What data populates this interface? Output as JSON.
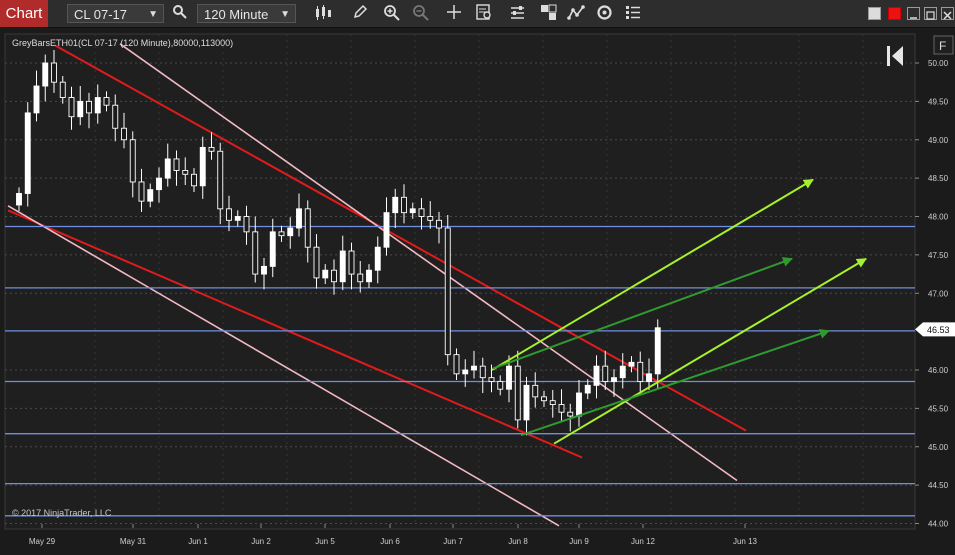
{
  "toolbar": {
    "tab_label": "Chart",
    "instrument": "CL 07-17",
    "interval": "120 Minute",
    "close_glyph_hint": ""
  },
  "chart": {
    "indicator_label": "GreyBarsETH01(CL 07-17 (120 Minute),80000,113000)",
    "copyright": "© 2017 NinjaTrader, LLC",
    "f_button": "F",
    "last_price_label": "46.53",
    "y_ticks": [
      "50.00",
      "49.50",
      "49.00",
      "48.50",
      "48.00",
      "47.50",
      "47.00",
      "46.53",
      "46.00",
      "45.50",
      "45.00",
      "44.50",
      "44.00"
    ],
    "x_labels": [
      "May 29",
      "May 31",
      "Jun 1",
      "Jun 2",
      "Jun 5",
      "Jun 6",
      "Jun 7",
      "Jun 8",
      "Jun 9",
      "Jun 12",
      "Jun 13"
    ]
  },
  "chart_data": {
    "type": "candlestick",
    "instrument": "CL 07-17",
    "interval": "120 Minute",
    "ylim": [
      44.0,
      50.15
    ],
    "x_categories": [
      "May 29",
      "May 31",
      "Jun 1",
      "Jun 2",
      "Jun 5",
      "Jun 6",
      "Jun 7",
      "Jun 8",
      "Jun 9",
      "Jun 12",
      "Jun 13"
    ],
    "last_price": 46.53,
    "horizontal_levels": [
      47.87,
      47.07,
      46.51,
      45.85,
      45.17,
      44.52,
      44.1
    ],
    "grid": true,
    "colors": {
      "background": "#1b1b1b",
      "grid": "#555555",
      "candle": "#ffffff",
      "level_line": "#6f8fe0",
      "channel_red": "#e01b1b",
      "channel_pink": "#f2b9c3",
      "arrow_lime": "#a6f22a",
      "arrow_green": "#2f9a2f",
      "tab_red": "#b12b2b"
    }
  }
}
